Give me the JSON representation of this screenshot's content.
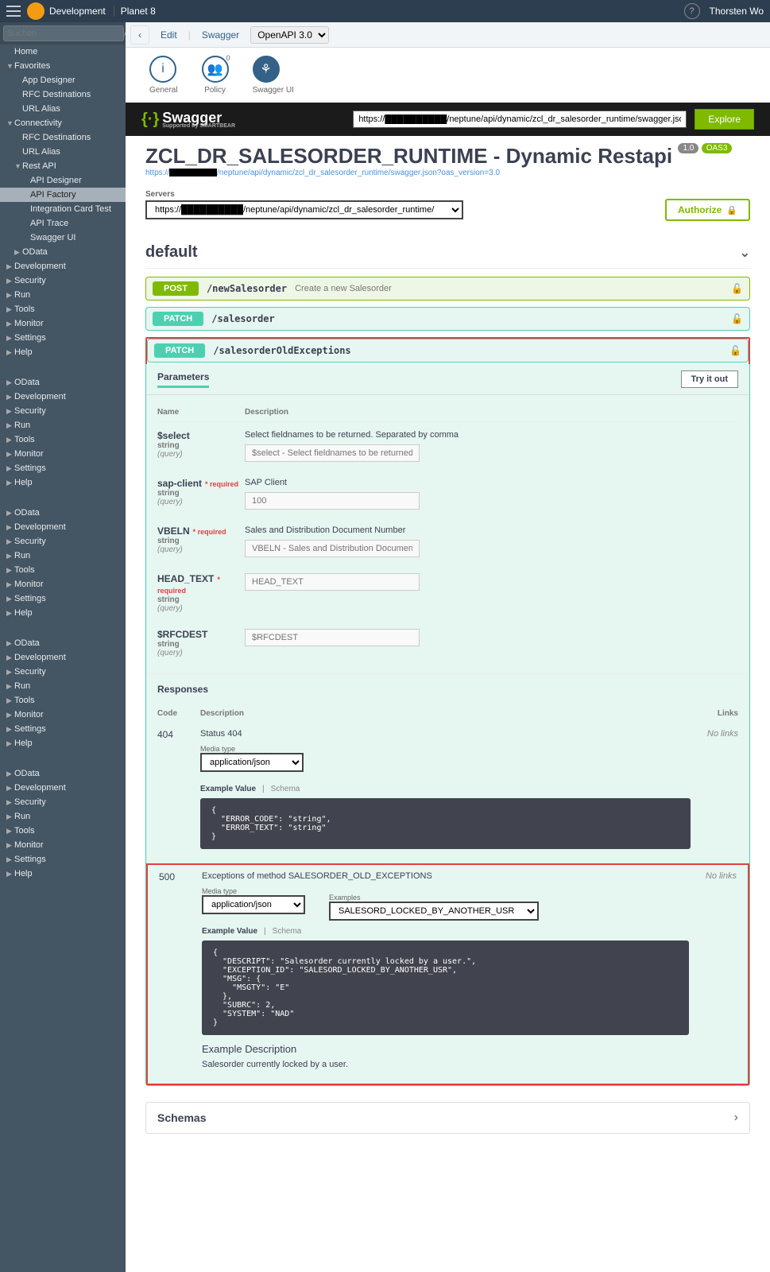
{
  "header": {
    "environment": "Development",
    "app": "Planet 8",
    "user": "Thorsten Wo"
  },
  "sidebar": {
    "search_placeholder": "Suchen",
    "groups": [
      {
        "items": [
          {
            "label": "Home",
            "l": 1,
            "arrow": ""
          },
          {
            "label": "Favorites",
            "l": 1,
            "arrow": "▼"
          },
          {
            "label": "App Designer",
            "l": 2,
            "arrow": ""
          },
          {
            "label": "RFC Destinations",
            "l": 2,
            "arrow": ""
          },
          {
            "label": "URL Alias",
            "l": 2,
            "arrow": ""
          },
          {
            "label": "Connectivity",
            "l": 1,
            "arrow": "▼"
          },
          {
            "label": "RFC Destinations",
            "l": 2,
            "arrow": ""
          },
          {
            "label": "URL Alias",
            "l": 2,
            "arrow": ""
          },
          {
            "label": "Rest API",
            "l": 2,
            "arrow": "▼"
          },
          {
            "label": "API Designer",
            "l": 3,
            "arrow": ""
          },
          {
            "label": "API Factory",
            "l": 3,
            "arrow": "",
            "selected": true
          },
          {
            "label": "Integration Card Test",
            "l": 3,
            "arrow": ""
          },
          {
            "label": "API Trace",
            "l": 3,
            "arrow": ""
          },
          {
            "label": "Swagger UI",
            "l": 3,
            "arrow": ""
          },
          {
            "label": "OData",
            "l": 2,
            "arrow": "▶"
          },
          {
            "label": "Development",
            "l": 1,
            "arrow": "▶"
          },
          {
            "label": "Security",
            "l": 1,
            "arrow": "▶"
          },
          {
            "label": "Run",
            "l": 1,
            "arrow": "▶"
          },
          {
            "label": "Tools",
            "l": 1,
            "arrow": "▶"
          },
          {
            "label": "Monitor",
            "l": 1,
            "arrow": "▶"
          },
          {
            "label": "Settings",
            "l": 1,
            "arrow": "▶"
          },
          {
            "label": "Help",
            "l": 1,
            "arrow": "▶"
          }
        ]
      },
      {
        "items": [
          {
            "label": "OData",
            "l": 1,
            "arrow": "▶"
          },
          {
            "label": "Development",
            "l": 1,
            "arrow": "▶"
          },
          {
            "label": "Security",
            "l": 1,
            "arrow": "▶"
          },
          {
            "label": "Run",
            "l": 1,
            "arrow": "▶"
          },
          {
            "label": "Tools",
            "l": 1,
            "arrow": "▶"
          },
          {
            "label": "Monitor",
            "l": 1,
            "arrow": "▶"
          },
          {
            "label": "Settings",
            "l": 1,
            "arrow": "▶"
          },
          {
            "label": "Help",
            "l": 1,
            "arrow": "▶"
          }
        ]
      },
      {
        "items": [
          {
            "label": "OData",
            "l": 1,
            "arrow": "▶"
          },
          {
            "label": "Development",
            "l": 1,
            "arrow": "▶"
          },
          {
            "label": "Security",
            "l": 1,
            "arrow": "▶"
          },
          {
            "label": "Run",
            "l": 1,
            "arrow": "▶"
          },
          {
            "label": "Tools",
            "l": 1,
            "arrow": "▶"
          },
          {
            "label": "Monitor",
            "l": 1,
            "arrow": "▶"
          },
          {
            "label": "Settings",
            "l": 1,
            "arrow": "▶"
          },
          {
            "label": "Help",
            "l": 1,
            "arrow": "▶"
          }
        ]
      },
      {
        "items": [
          {
            "label": "OData",
            "l": 1,
            "arrow": "▶"
          },
          {
            "label": "Development",
            "l": 1,
            "arrow": "▶"
          },
          {
            "label": "Security",
            "l": 1,
            "arrow": "▶"
          },
          {
            "label": "Run",
            "l": 1,
            "arrow": "▶"
          },
          {
            "label": "Tools",
            "l": 1,
            "arrow": "▶"
          },
          {
            "label": "Monitor",
            "l": 1,
            "arrow": "▶"
          },
          {
            "label": "Settings",
            "l": 1,
            "arrow": "▶"
          },
          {
            "label": "Help",
            "l": 1,
            "arrow": "▶"
          }
        ]
      },
      {
        "items": [
          {
            "label": "OData",
            "l": 1,
            "arrow": "▶"
          },
          {
            "label": "Development",
            "l": 1,
            "arrow": "▶"
          },
          {
            "label": "Security",
            "l": 1,
            "arrow": "▶"
          },
          {
            "label": "Run",
            "l": 1,
            "arrow": "▶"
          },
          {
            "label": "Tools",
            "l": 1,
            "arrow": "▶"
          },
          {
            "label": "Monitor",
            "l": 1,
            "arrow": "▶"
          },
          {
            "label": "Settings",
            "l": 1,
            "arrow": "▶"
          },
          {
            "label": "Help",
            "l": 1,
            "arrow": "▶"
          }
        ]
      }
    ]
  },
  "toolbar": {
    "edit": "Edit",
    "swagger": "Swagger",
    "openapi": "OpenAPI 3.0"
  },
  "icons": {
    "general": "General",
    "policy": "Policy",
    "swagger_ui": "Swagger UI"
  },
  "swagger": {
    "logo": "Swagger",
    "logo_sub": "Supported by SMARTBEAR",
    "url_prefix": "https://",
    "url_suffix": "/neptune/api/dynamic/zcl_dr_salesorder_runtime/swagger.json?oas_",
    "explore": "Explore"
  },
  "api": {
    "title": "ZCL_DR_SALESORDER_RUNTIME - Dynamic Restapi",
    "version": "1.0",
    "oas": "OAS3",
    "link_prefix": "https://",
    "link_suffix": "/neptune/api/dynamic/zcl_dr_salesorder_runtime/swagger.json?oas_version=3.0",
    "servers_label": "Servers",
    "server_prefix": "https://",
    "server_suffix": "/neptune/api/dynamic/zcl_dr_salesorder_runtime/",
    "authorize": "Authorize",
    "section": "default"
  },
  "endpoints": [
    {
      "method": "POST",
      "mclass": "post",
      "path": "/newSalesorder",
      "desc": "Create a new Salesorder"
    },
    {
      "method": "PATCH",
      "mclass": "patch",
      "path": "/salesorder",
      "desc": ""
    },
    {
      "method": "PATCH",
      "mclass": "patch",
      "path": "/salesorderOldExceptions",
      "desc": "",
      "expanded": true,
      "highlight": true
    }
  ],
  "params_section": {
    "title": "Parameters",
    "tryit": "Try it out",
    "col_name": "Name",
    "col_desc": "Description",
    "rows": [
      {
        "name": "$select",
        "req": false,
        "type": "string",
        "loc": "(query)",
        "desc": "Select fieldnames to be returned. Separated by comma",
        "placeholder": "$select - Select fieldnames to be returned. Separat"
      },
      {
        "name": "sap-client",
        "req": true,
        "type": "string",
        "loc": "(query)",
        "desc": "SAP Client",
        "placeholder": "100"
      },
      {
        "name": "VBELN",
        "req": true,
        "type": "string",
        "loc": "(query)",
        "desc": "Sales and Distribution Document Number",
        "placeholder": "VBELN - Sales and Distribution Document Number"
      },
      {
        "name": "HEAD_TEXT",
        "req": true,
        "type": "string",
        "loc": "(query)",
        "desc": "",
        "placeholder": "HEAD_TEXT"
      },
      {
        "name": "$RFCDEST",
        "req": false,
        "type": "string",
        "loc": "(query)",
        "desc": "",
        "placeholder": "$RFCDEST"
      }
    ]
  },
  "responses": {
    "title": "Responses",
    "col_code": "Code",
    "col_desc": "Description",
    "col_links": "Links",
    "no_links": "No links",
    "media_label": "Media type",
    "examples_label": "Examples",
    "example_value": "Example Value",
    "schema": "Schema",
    "rows": [
      {
        "code": "404",
        "desc": "Status 404",
        "media": "application/json",
        "code_body": "{\n  \"ERROR_CODE\": \"string\",\n  \"ERROR_TEXT\": \"string\"\n}"
      },
      {
        "code": "500",
        "desc": "Exceptions of method SALESORDER_OLD_EXCEPTIONS",
        "media": "application/json",
        "example_sel": "SALESORD_LOCKED_BY_ANOTHER_USR",
        "code_body": "{\n  \"DESCRIPT\": \"Salesorder currently locked by a user.\",\n  \"EXCEPTION_ID\": \"SALESORD_LOCKED_BY_ANOTHER_USR\",\n  \"MSG\": {\n    \"MSGTY\": \"E\"\n  },\n  \"SUBRC\": 2,\n  \"SYSTEM\": \"NAD\"\n}",
        "ex_desc_hdr": "Example Description",
        "ex_desc": "Salesorder currently locked by a user.",
        "highlight": true
      }
    ]
  },
  "schemas": {
    "title": "Schemas"
  }
}
